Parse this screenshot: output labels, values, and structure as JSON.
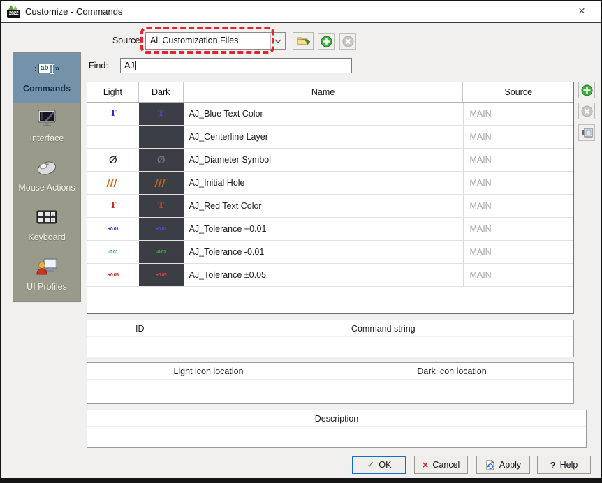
{
  "window": {
    "title": "Customize - Commands",
    "app_icon": "ironcad-2022",
    "close_icon": "×"
  },
  "source_bar": {
    "label": "Source:",
    "value": "All Customization Files",
    "annotation": {
      "type": "red-dashed-highlight",
      "color": "#e52330",
      "target": "source-dropdown"
    },
    "buttons": [
      {
        "name": "open-customization-file",
        "icon": "folder-open-icon",
        "disabled": false
      },
      {
        "name": "add-customization-file",
        "icon": "green-plus-icon",
        "disabled": false
      },
      {
        "name": "remove-customization-file",
        "icon": "gray-x-icon",
        "disabled": true
      }
    ]
  },
  "sidebar": {
    "items": [
      {
        "label": "Commands",
        "icon": "commands-icon",
        "selected": true
      },
      {
        "label": "Interface",
        "icon": "interface-monitor-icon",
        "selected": false
      },
      {
        "label": "Mouse Actions",
        "icon": "mouse-icon",
        "selected": false
      },
      {
        "label": "Keyboard",
        "icon": "keyboard-icon",
        "selected": false
      },
      {
        "label": "UI Profiles",
        "icon": "user-profile-icon",
        "selected": false
      }
    ]
  },
  "find": {
    "label": "Find:",
    "value": "AJ"
  },
  "table": {
    "columns": [
      "Light",
      "Dark",
      "Name",
      "Source"
    ],
    "rows": [
      {
        "icon": "T",
        "icon_name": "blue-text-icon",
        "name": "AJ_Blue Text Color",
        "source": "MAIN"
      },
      {
        "icon": "",
        "icon_name": "none",
        "name": "AJ_Centerline Layer",
        "source": "MAIN"
      },
      {
        "icon": "Ø",
        "icon_name": "diameter-symbol-icon",
        "name": "AJ_Diameter Symbol",
        "source": "MAIN"
      },
      {
        "icon": "",
        "icon_name": "hatch-icon",
        "name": "AJ_Initial Hole",
        "source": "MAIN"
      },
      {
        "icon": "T",
        "icon_name": "red-text-icon",
        "name": "AJ_Red Text Color",
        "source": "MAIN"
      },
      {
        "icon": "+0.01",
        "icon_name": "tolerance-plus-icon",
        "name": "AJ_Tolerance +0.01",
        "source": "MAIN"
      },
      {
        "icon": "-0.01",
        "icon_name": "tolerance-minus-icon",
        "name": "AJ_Tolerance -0.01",
        "source": "MAIN"
      },
      {
        "icon": "+0.05",
        "icon_name": "tolerance-pm-icon",
        "name": "AJ_Tolerance ±0.05",
        "source": "MAIN"
      }
    ],
    "actions": [
      {
        "name": "add-command",
        "icon": "green-plus-icon",
        "disabled": false
      },
      {
        "name": "remove-command",
        "icon": "gray-x-icon",
        "disabled": true
      },
      {
        "name": "icon-editor",
        "icon": "icon-editor-icon",
        "disabled": false
      }
    ]
  },
  "panels": {
    "id": "ID",
    "command_string": "Command string",
    "light_icon_location": "Light icon location",
    "dark_icon_location": "Dark icon location",
    "description": "Description"
  },
  "footer": {
    "ok": "OK",
    "ok_icon": "✓",
    "cancel": "Cancel",
    "cancel_icon": "×",
    "apply": "Apply",
    "help": "Help",
    "help_icon": "?"
  },
  "colors": {
    "sidebar_olive": "#9a9a8b",
    "selected_blue": "#7493ab",
    "dark_cell": "#3b3f45",
    "annotation_red": "#e52330",
    "default_button_border": "#0b6fd0"
  }
}
